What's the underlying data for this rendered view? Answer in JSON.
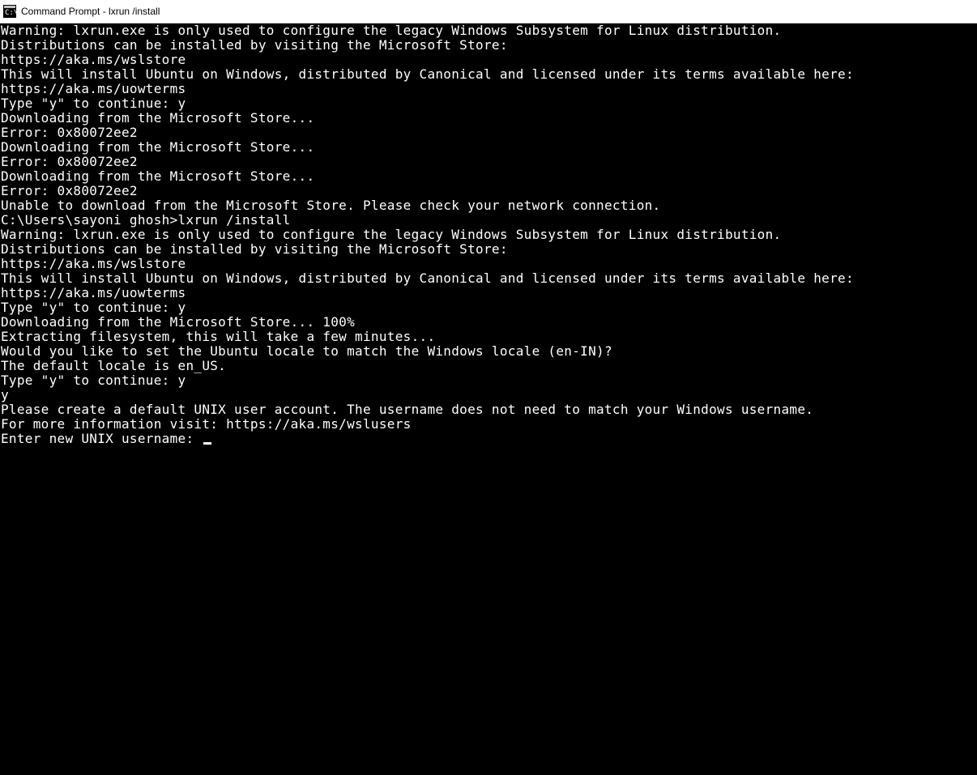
{
  "titlebar": {
    "title": "Command Prompt - lxrun  /install"
  },
  "terminal": {
    "lines": [
      "Warning: lxrun.exe is only used to configure the legacy Windows Subsystem for Linux distribution.",
      "Distributions can be installed by visiting the Microsoft Store:",
      "https://aka.ms/wslstore",
      "",
      "This will install Ubuntu on Windows, distributed by Canonical and licensed under its terms available here:",
      "https://aka.ms/uowterms",
      "",
      "Type \"y\" to continue: y",
      "Downloading from the Microsoft Store...",
      "Error: 0x80072ee2",
      "Downloading from the Microsoft Store...",
      "Error: 0x80072ee2",
      "Downloading from the Microsoft Store...",
      "Error: 0x80072ee2",
      "Unable to download from the Microsoft Store. Please check your network connection.",
      "",
      "C:\\Users\\sayoni ghosh>lxrun /install",
      "Warning: lxrun.exe is only used to configure the legacy Windows Subsystem for Linux distribution.",
      "Distributions can be installed by visiting the Microsoft Store:",
      "https://aka.ms/wslstore",
      "",
      "This will install Ubuntu on Windows, distributed by Canonical and licensed under its terms available here:",
      "https://aka.ms/uowterms",
      "",
      "Type \"y\" to continue: y",
      "Downloading from the Microsoft Store... 100%",
      "Extracting filesystem, this will take a few minutes...",
      "Would you like to set the Ubuntu locale to match the Windows locale (en-IN)?",
      "The default locale is en_US.",
      "Type \"y\" to continue: y",
      "y",
      "Please create a default UNIX user account. The username does not need to match your Windows username.",
      "For more information visit: https://aka.ms/wslusers"
    ],
    "prompt": "Enter new UNIX username: "
  }
}
